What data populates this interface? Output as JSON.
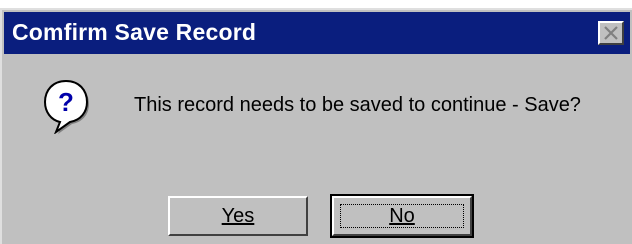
{
  "dialog": {
    "title": "Comfirm Save Record",
    "message": "This record needs to be saved to continue - Save?",
    "icon": "question-icon",
    "buttons": {
      "yes_label": "Yes",
      "no_label": "No"
    }
  },
  "colors": {
    "titlebar": "#0a1e7e",
    "dialog_bg": "#c0c0c0"
  }
}
